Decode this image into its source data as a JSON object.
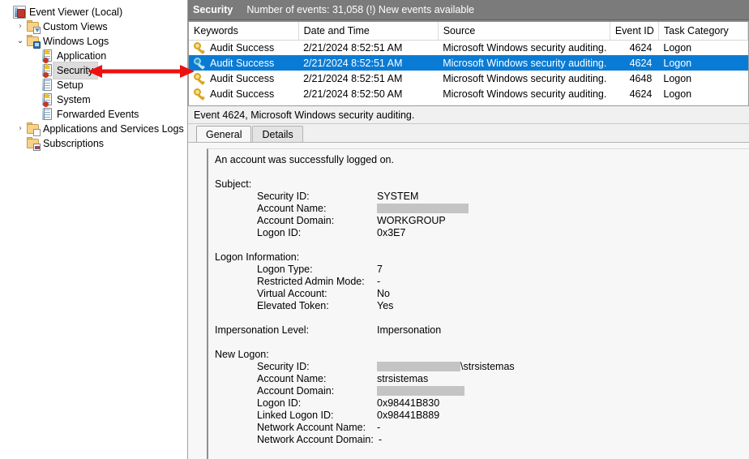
{
  "tree": {
    "items": [
      {
        "label": "Event Viewer (Local)",
        "icon": "event-viewer-icon",
        "indent": 0,
        "twisty": "",
        "selected": false
      },
      {
        "label": "Custom Views",
        "icon": "folder-funnel-icon",
        "indent": 1,
        "twisty": "›",
        "selected": false
      },
      {
        "label": "Windows Logs",
        "icon": "folder-monitor-icon",
        "indent": 1,
        "twisty": "⌄",
        "selected": false
      },
      {
        "label": "Application",
        "icon": "log-warn-icon",
        "indent": 2,
        "twisty": "",
        "selected": false
      },
      {
        "label": "Security",
        "icon": "log-warn-icon",
        "indent": 2,
        "twisty": "",
        "selected": true
      },
      {
        "label": "Setup",
        "icon": "log-plain-icon",
        "indent": 2,
        "twisty": "",
        "selected": false
      },
      {
        "label": "System",
        "icon": "log-warn-icon",
        "indent": 2,
        "twisty": "",
        "selected": false
      },
      {
        "label": "Forwarded Events",
        "icon": "log-plain-icon",
        "indent": 2,
        "twisty": "",
        "selected": false
      },
      {
        "label": "Applications and Services Logs",
        "icon": "folder-page-icon",
        "indent": 1,
        "twisty": "›",
        "selected": false
      },
      {
        "label": "Subscriptions",
        "icon": "folder-subs-icon",
        "indent": 1,
        "twisty": "",
        "selected": false
      }
    ]
  },
  "log_header": {
    "title": "Security",
    "count_text": "Number of events: 31,058 (!) New events available"
  },
  "event_list": {
    "columns": [
      "Keywords",
      "Date and Time",
      "Source",
      "Event ID",
      "Task Category"
    ],
    "rows": [
      {
        "keywords": "Audit Success",
        "datetime": "2/21/2024 8:52:51 AM",
        "source": "Microsoft Windows security auditing.",
        "event_id": "4624",
        "task_category": "Logon",
        "selected": false
      },
      {
        "keywords": "Audit Success",
        "datetime": "2/21/2024 8:52:51 AM",
        "source": "Microsoft Windows security auditing.",
        "event_id": "4624",
        "task_category": "Logon",
        "selected": true
      },
      {
        "keywords": "Audit Success",
        "datetime": "2/21/2024 8:52:51 AM",
        "source": "Microsoft Windows security auditing.",
        "event_id": "4648",
        "task_category": "Logon",
        "selected": false
      },
      {
        "keywords": "Audit Success",
        "datetime": "2/21/2024 8:52:50 AM",
        "source": "Microsoft Windows security auditing.",
        "event_id": "4624",
        "task_category": "Logon",
        "selected": false
      }
    ]
  },
  "detail": {
    "title": "Event 4624, Microsoft Windows security auditing.",
    "tabs": [
      {
        "label": "General",
        "active": true
      },
      {
        "label": "Details",
        "active": false
      }
    ],
    "summary": "An account was successfully logged on.",
    "sections": [
      {
        "heading": "Subject:",
        "fields": [
          {
            "label": "Security ID:",
            "value": "SYSTEM",
            "redacted": false
          },
          {
            "label": "Account Name:",
            "value": "",
            "redacted": true,
            "redact_width": 113
          },
          {
            "label": "Account Domain:",
            "value": "WORKGROUP",
            "redacted": false
          },
          {
            "label": "Logon ID:",
            "value": "0x3E7",
            "redacted": false
          }
        ]
      },
      {
        "heading": "Logon Information:",
        "fields": [
          {
            "label": "Logon Type:",
            "value": "7",
            "redacted": false
          },
          {
            "label": "Restricted Admin Mode:",
            "value": "-",
            "redacted": false
          },
          {
            "label": "Virtual Account:",
            "value": "No",
            "redacted": false
          },
          {
            "label": "Elevated Token:",
            "value": "Yes",
            "redacted": false
          }
        ]
      },
      {
        "heading": "Impersonation Level:",
        "heading_value": "Impersonation",
        "fields": []
      },
      {
        "heading": "New Logon:",
        "fields": [
          {
            "label": "Security ID:",
            "value": "\\strsistemas",
            "redacted": true,
            "redact_width": 103,
            "redact_before": true
          },
          {
            "label": "Account Name:",
            "value": "strsistemas",
            "redacted": false
          },
          {
            "label": "Account Domain:",
            "value": "",
            "redacted": true,
            "redact_width": 108
          },
          {
            "label": "Logon ID:",
            "value": "0x98441B830",
            "redacted": false
          },
          {
            "label": "Linked Logon ID:",
            "value": "0x98441B889",
            "redacted": false
          },
          {
            "label": "Network Account Name:",
            "value": "-",
            "redacted": false
          },
          {
            "label": "Network Account Domain:",
            "value": "-",
            "redacted": false,
            "inline_value": true
          }
        ]
      }
    ]
  },
  "annotation": {
    "arrow_color": "#ee1111",
    "name": "double-headed-arrow"
  }
}
